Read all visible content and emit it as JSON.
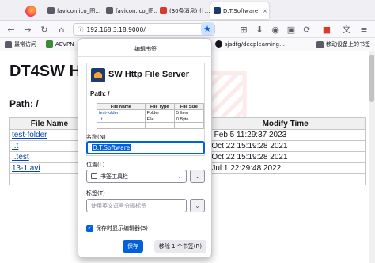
{
  "browser": {
    "tabs": [
      {
        "label": "favicon.ico_图…",
        "fav": "#5a5a66"
      },
      {
        "label": "favicon.ico_图…",
        "fav": "#5a5a66"
      },
      {
        "label": "(30条消息) 什…",
        "fav": "#d83b2a"
      },
      {
        "label": "D.T.Software",
        "fav": "#1f3a6d"
      }
    ],
    "url": "192.168.3.18:9000/",
    "bookmarks": [
      {
        "label": "最常访问",
        "fav": "#5b5b66"
      },
      {
        "label": "AEVPN",
        "fav": "#3a8a3a"
      },
      {
        "label": "sjsdfg/deeplearning…",
        "fav": "#15141a"
      },
      {
        "label": "移动设备上的书签",
        "fav": "#5b5b66"
      }
    ]
  },
  "page": {
    "heading": "DT4SW Ht",
    "path_label": "Path: /",
    "columns": [
      "File Name",
      "Modify Time"
    ],
    "rows": [
      {
        "name": "test-folder",
        "time": "n Feb 5 11:29:37 2023"
      },
      {
        "name": "..t",
        "time": "i Oct 22 15:19:28 2021"
      },
      {
        "name": "..test",
        "time": "i Oct 22 15:19:28 2021"
      },
      {
        "name": "13-1.avi",
        "time": "i Jul 1 22:29:48 2022"
      },
      {
        "name": "",
        "time": ""
      }
    ]
  },
  "dialog": {
    "title": "编辑书签",
    "preview": {
      "title": "SW Http File Server",
      "path": "Path: /",
      "columns": [
        "File Name",
        "File Type",
        "File Size"
      ],
      "rows": [
        [
          "test-folder",
          "Folder",
          "5 Item"
        ],
        [
          "..t",
          "File",
          "0 Byte"
        ],
        [
          "",
          "",
          ""
        ]
      ]
    },
    "name_label": "名称(N)",
    "name_value": "D.T.Software",
    "location_label": "位置(L)",
    "location_value": "书签工具栏",
    "tags_label": "标签(T)",
    "tags_placeholder": "使用英文逗号分隔标签",
    "checkbox_label": "保存时显示编辑器(S)",
    "save_label": "保存",
    "remove_label": "移除 1 个书签(R)"
  }
}
